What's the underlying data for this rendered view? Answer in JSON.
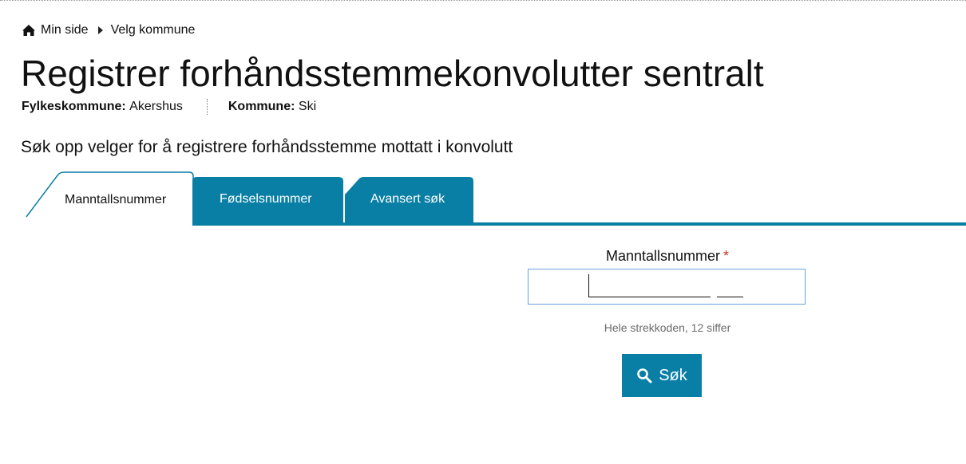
{
  "breadcrumb": {
    "home_icon": "home-icon",
    "separator_icon": "caret-right-icon",
    "items": [
      {
        "label": "Min side"
      },
      {
        "label": "Velg kommune"
      }
    ]
  },
  "page": {
    "title": "Registrer forhåndsstemmekonvolutter sentralt"
  },
  "meta": {
    "county_label": "Fylkeskommune:",
    "county_value": "Akershus",
    "municipality_label": "Kommune:",
    "municipality_value": "Ski"
  },
  "instruction": "Søk opp velger for å registrere forhåndsstemme mottatt i konvolutt",
  "tabs": [
    {
      "label": "Manntallsnummer",
      "active": true
    },
    {
      "label": "Fødselsnummer",
      "active": false
    },
    {
      "label": "Avansert søk",
      "active": false
    }
  ],
  "form": {
    "field_label": "Manntallsnummer",
    "required_marker": "*",
    "value": "",
    "hint": "Hele strekkoden, 12 siffer",
    "submit_label": "Søk",
    "submit_icon": "search-icon"
  },
  "colors": {
    "accent": "#0a7fa6",
    "input_border": "#6aa3d6",
    "required": "#c0392b",
    "hint_text": "#6b6b6b"
  }
}
